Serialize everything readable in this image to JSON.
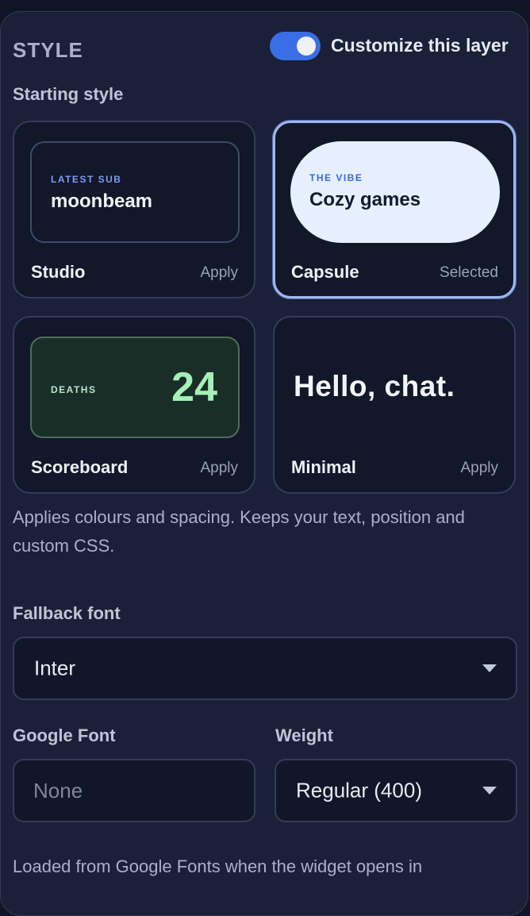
{
  "header": {
    "section_title": "STYLE",
    "toggle_label": "Customize this layer",
    "toggle_on": true
  },
  "starting_style": {
    "label": "Starting style",
    "cards": [
      {
        "name": "Studio",
        "action": "Apply",
        "preview_kicker": "LATEST SUB",
        "preview_text": "moonbeam"
      },
      {
        "name": "Capsule",
        "action": "Selected",
        "preview_kicker": "THE VIBE",
        "preview_text": "Cozy games",
        "selected": true
      },
      {
        "name": "Scoreboard",
        "action": "Apply",
        "preview_kicker": "DEATHS",
        "preview_text": "24"
      },
      {
        "name": "Minimal",
        "action": "Apply",
        "preview_text": "Hello, chat."
      }
    ],
    "help": "Applies colours and spacing. Keeps your text, position and custom CSS."
  },
  "fallback_font": {
    "label": "Fallback font",
    "value": "Inter"
  },
  "google_font": {
    "label": "Google Font",
    "placeholder": "None",
    "value": ""
  },
  "weight": {
    "label": "Weight",
    "value": "Regular (400)"
  },
  "footer_help": "Loaded from Google Fonts when the widget opens in"
}
